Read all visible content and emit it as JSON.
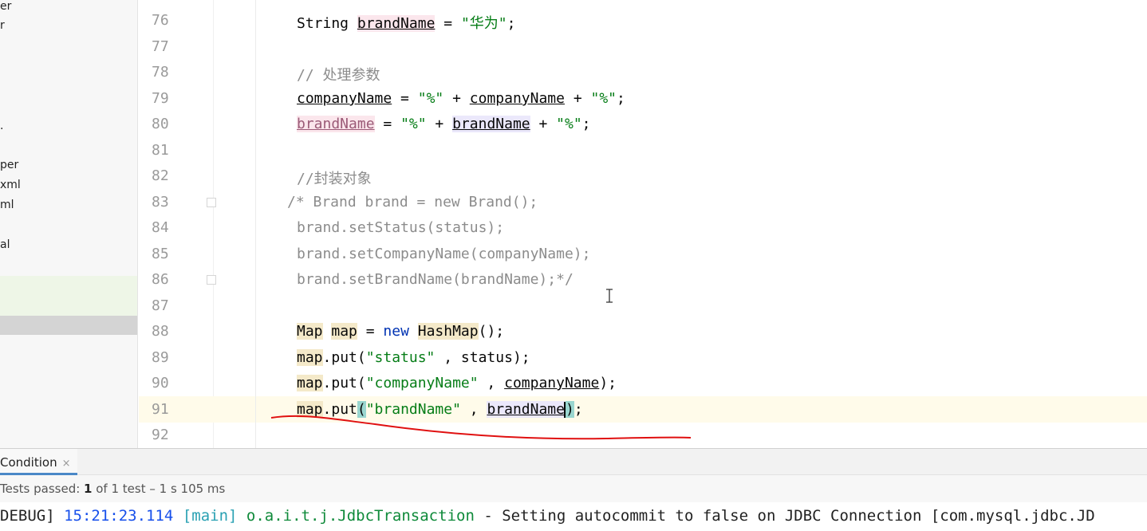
{
  "project_tree": {
    "items": [
      "er",
      "r",
      ".",
      "per",
      "xml",
      "ml",
      "al"
    ]
  },
  "gutter": {
    "line_numbers": [
      "76",
      "77",
      "78",
      "79",
      "80",
      "81",
      "82",
      "83",
      "84",
      "85",
      "86",
      "87",
      "88",
      "89",
      "90",
      "91",
      "92"
    ]
  },
  "editor": {
    "l76": {
      "kw": "String",
      "var": "brandName",
      "eq": " = ",
      "str": "\"华为\"",
      "end": ";"
    },
    "l78": {
      "comment": "// 处理参数"
    },
    "l79": {
      "var": "companyName",
      "mid1": " = ",
      "s1": "\"%\"",
      "plus1": " + ",
      "var2": "companyName",
      "plus2": " + ",
      "s2": "\"%\"",
      "end": ";"
    },
    "l80": {
      "var": "brandName",
      "mid1": " = ",
      "s1": "\"%\"",
      "plus1": " + ",
      "var2": "brandName",
      "plus2": " + ",
      "s2": "\"%\"",
      "end": ";"
    },
    "l82": {
      "comment": "//封装对象"
    },
    "l83": {
      "comment": "/* Brand brand = new Brand();"
    },
    "l84": {
      "comment": "brand.setStatus(status);"
    },
    "l85": {
      "comment": "brand.setCompanyName(companyName);"
    },
    "l86": {
      "comment": "brand.setBrandName(brandName);*/"
    },
    "l88": {
      "t1": "Map",
      "t2": "map",
      "eq": " = ",
      "kw": "new",
      "t3": "HashMap",
      "end": "();"
    },
    "l89": {
      "obj": "map",
      "call": ".put(",
      "str": "\"status\"",
      "sep": " , ",
      "arg": "status",
      "end": ");"
    },
    "l90": {
      "obj": "map",
      "call": ".put(",
      "str": "\"companyName\"",
      "sep": " , ",
      "arg": "companyName",
      "end": ");"
    },
    "l91": {
      "obj": "map",
      "call": ".put",
      "paren": "(",
      "str": "\"brandName\"",
      "sep": " , ",
      "arg": "brandName",
      "close": ")",
      "end": ";"
    }
  },
  "run_panel": {
    "tab_label": "Condition",
    "tab_close": "×",
    "tests_prefix": "Tests passed: ",
    "tests_passed": "1",
    "tests_rest": " of 1 test – 1 s 105 ms"
  },
  "console": {
    "level": "DEBUG] ",
    "timestamp": "15:21:23.114",
    "thread": "[main]",
    "logger": "o.a.i.t.j.JdbcTransaction",
    "message": " - Setting autocommit to false on JDBC Connection [com.mysql.jdbc.JD"
  },
  "colors": {
    "string": "#067d17",
    "keyword": "#0033b3",
    "comment": "#8c8c8c",
    "annotation": "#e01010"
  }
}
